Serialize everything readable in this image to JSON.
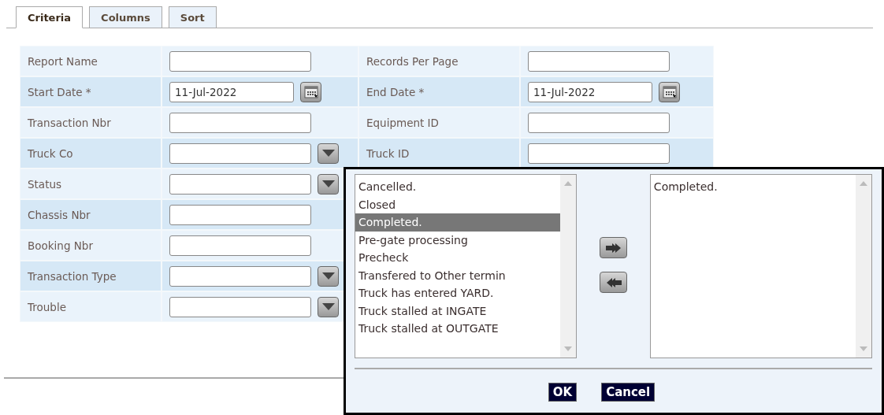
{
  "tabs": [
    {
      "label": "Criteria",
      "selected": true
    },
    {
      "label": "Columns",
      "selected": false
    },
    {
      "label": "Sort",
      "selected": false
    }
  ],
  "form_rows": [
    {
      "left": {
        "label": "Report Name",
        "kind": "text"
      },
      "right": {
        "label": "Records Per Page",
        "kind": "text"
      }
    },
    {
      "left": {
        "label": "Start Date *",
        "kind": "date",
        "value": "11-Jul-2022"
      },
      "right": {
        "label": "End Date *",
        "kind": "date",
        "value": "11-Jul-2022"
      }
    },
    {
      "left": {
        "label": "Transaction Nbr",
        "kind": "text"
      },
      "right": {
        "label": "Equipment ID",
        "kind": "text"
      }
    },
    {
      "left": {
        "label": "Truck Co",
        "kind": "select"
      },
      "right": {
        "label": "Truck ID",
        "kind": "text"
      }
    },
    {
      "left": {
        "label": "Status",
        "kind": "select"
      }
    },
    {
      "left": {
        "label": "Chassis Nbr",
        "kind": "text"
      }
    },
    {
      "left": {
        "label": "Booking Nbr",
        "kind": "text"
      }
    },
    {
      "left": {
        "label": "Transaction Type",
        "kind": "select"
      }
    },
    {
      "left": {
        "label": "Trouble",
        "kind": "select"
      }
    }
  ],
  "picker": {
    "available": [
      {
        "label": "Cancelled.",
        "selected": false
      },
      {
        "label": "Closed",
        "selected": false
      },
      {
        "label": "Completed.",
        "selected": true
      },
      {
        "label": "Pre-gate processing",
        "selected": false
      },
      {
        "label": "Precheck",
        "selected": false
      },
      {
        "label": "Transfered to Other termin",
        "selected": false
      },
      {
        "label": "Truck has entered YARD.",
        "selected": false
      },
      {
        "label": "Truck stalled at INGATE",
        "selected": false
      },
      {
        "label": "Truck stalled at OUTGATE",
        "selected": false
      }
    ],
    "chosen": [
      "Completed."
    ],
    "buttons": [
      "OK",
      "Cancel"
    ]
  }
}
